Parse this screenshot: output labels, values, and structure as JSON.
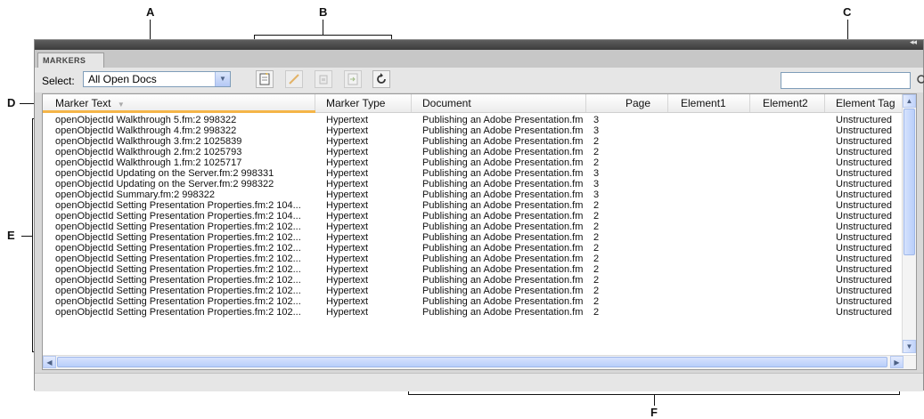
{
  "callouts": {
    "a": "A",
    "b": "B",
    "c": "C",
    "d": "D",
    "e": "E",
    "f": "F"
  },
  "panel": {
    "tab_label": "MARKERS",
    "collapse_glyph": "◂◂"
  },
  "toolbar": {
    "select_label": "Select:",
    "select_value": "All Open Docs",
    "search_value": "",
    "buttons": [
      "new-marker",
      "edit-marker",
      "delete-marker",
      "go-to-marker",
      "refresh"
    ]
  },
  "table": {
    "columns": [
      "Marker Text",
      "Marker Type",
      "Document",
      "Page",
      "Element1",
      "Element2",
      "Element Tag"
    ],
    "sorted_column": "Marker Text",
    "rows": [
      [
        "openObjectId Walkthrough 5.fm:2 998322",
        "Hypertext",
        "Publishing an Adobe Presentation.fm",
        "3",
        "",
        "",
        "Unstructured"
      ],
      [
        "openObjectId Walkthrough 4.fm:2 998322",
        "Hypertext",
        "Publishing an Adobe Presentation.fm",
        "3",
        "",
        "",
        "Unstructured"
      ],
      [
        "openObjectId Walkthrough 3.fm:2 1025839",
        "Hypertext",
        "Publishing an Adobe Presentation.fm",
        "2",
        "",
        "",
        "Unstructured"
      ],
      [
        "openObjectId Walkthrough 2.fm:2 1025793",
        "Hypertext",
        "Publishing an Adobe Presentation.fm",
        "2",
        "",
        "",
        "Unstructured"
      ],
      [
        "openObjectId Walkthrough 1.fm:2 1025717",
        "Hypertext",
        "Publishing an Adobe Presentation.fm",
        "2",
        "",
        "",
        "Unstructured"
      ],
      [
        "openObjectId Updating on the Server.fm:2 998331",
        "Hypertext",
        "Publishing an Adobe Presentation.fm",
        "3",
        "",
        "",
        "Unstructured"
      ],
      [
        "openObjectId Updating on the Server.fm:2 998322",
        "Hypertext",
        "Publishing an Adobe Presentation.fm",
        "3",
        "",
        "",
        "Unstructured"
      ],
      [
        "openObjectId Summary.fm:2 998322",
        "Hypertext",
        "Publishing an Adobe Presentation.fm",
        "3",
        "",
        "",
        "Unstructured"
      ],
      [
        "openObjectId Setting Presentation Properties.fm:2 104...",
        "Hypertext",
        "Publishing an Adobe Presentation.fm",
        "2",
        "",
        "",
        "Unstructured"
      ],
      [
        "openObjectId Setting Presentation Properties.fm:2 104...",
        "Hypertext",
        "Publishing an Adobe Presentation.fm",
        "2",
        "",
        "",
        "Unstructured"
      ],
      [
        "openObjectId Setting Presentation Properties.fm:2 102...",
        "Hypertext",
        "Publishing an Adobe Presentation.fm",
        "2",
        "",
        "",
        "Unstructured"
      ],
      [
        "openObjectId Setting Presentation Properties.fm:2 102...",
        "Hypertext",
        "Publishing an Adobe Presentation.fm",
        "2",
        "",
        "",
        "Unstructured"
      ],
      [
        "openObjectId Setting Presentation Properties.fm:2 102...",
        "Hypertext",
        "Publishing an Adobe Presentation.fm",
        "2",
        "",
        "",
        "Unstructured"
      ],
      [
        "openObjectId Setting Presentation Properties.fm:2 102...",
        "Hypertext",
        "Publishing an Adobe Presentation.fm",
        "2",
        "",
        "",
        "Unstructured"
      ],
      [
        "openObjectId Setting Presentation Properties.fm:2 102...",
        "Hypertext",
        "Publishing an Adobe Presentation.fm",
        "2",
        "",
        "",
        "Unstructured"
      ],
      [
        "openObjectId Setting Presentation Properties.fm:2 102...",
        "Hypertext",
        "Publishing an Adobe Presentation.fm",
        "2",
        "",
        "",
        "Unstructured"
      ],
      [
        "openObjectId Setting Presentation Properties.fm:2 102...",
        "Hypertext",
        "Publishing an Adobe Presentation.fm",
        "2",
        "",
        "",
        "Unstructured"
      ],
      [
        "openObjectId Setting Presentation Properties.fm:2 102...",
        "Hypertext",
        "Publishing an Adobe Presentation.fm",
        "2",
        "",
        "",
        "Unstructured"
      ],
      [
        "openObjectId Setting Presentation Properties.fm:2 102...",
        "Hypertext",
        "Publishing an Adobe Presentation.fm",
        "2",
        "",
        "",
        "Unstructured"
      ]
    ]
  },
  "colors": {
    "sort_indicator": "#f5b548",
    "titlebar": "#4a4a4a",
    "panel_bg": "#e6e6e6"
  }
}
